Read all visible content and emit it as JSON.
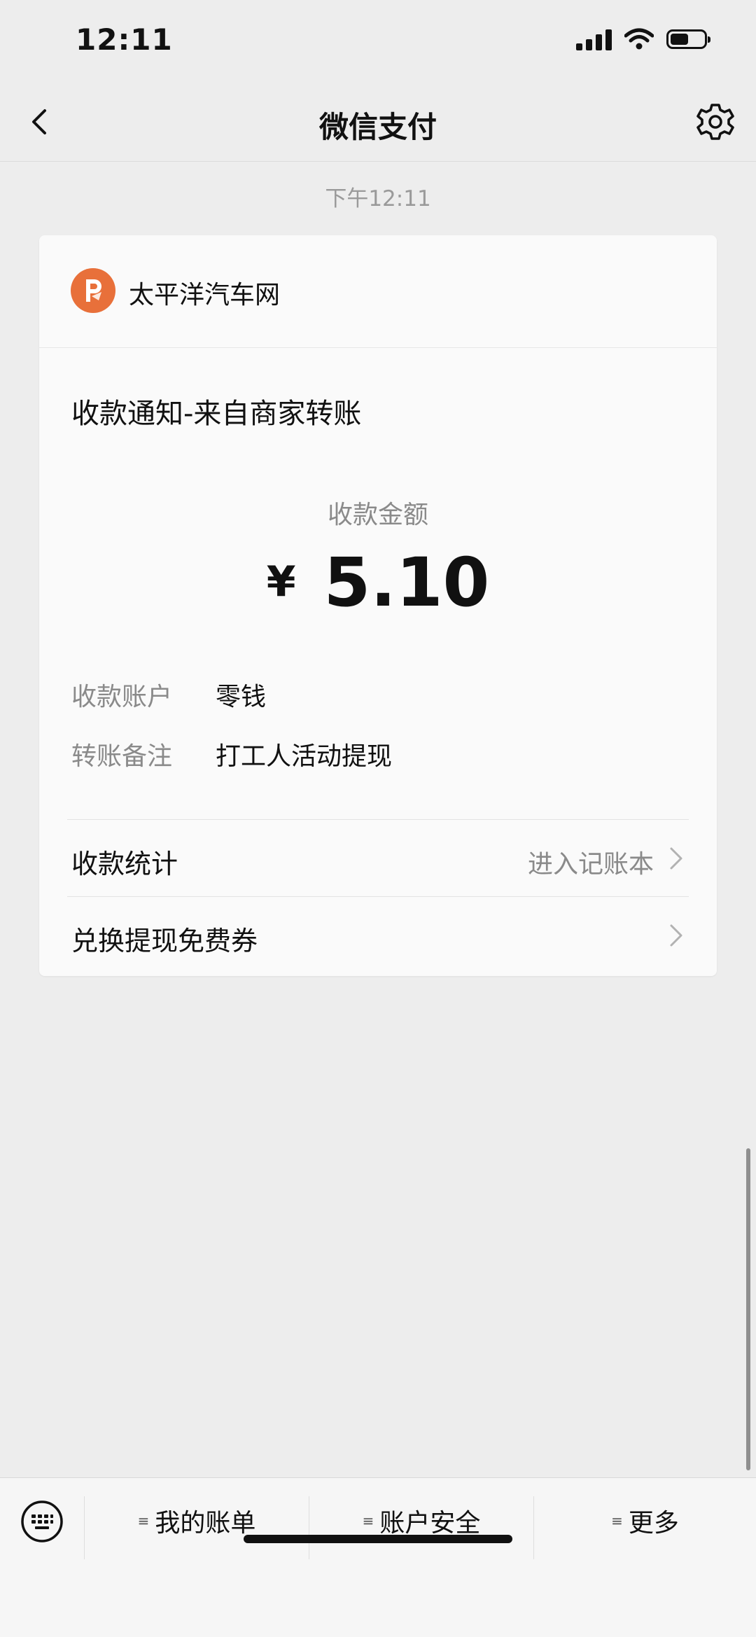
{
  "status_bar": {
    "time": "12:11",
    "battery_level": 0.55,
    "signal_bars": 4
  },
  "nav": {
    "title": "微信支付",
    "back_icon": "chevron-left-icon",
    "settings_icon": "gear-icon"
  },
  "chat": {
    "timestamp": "下午12:11"
  },
  "card": {
    "merchant_name": "太平洋汽车网",
    "merchant_logo_color": "#e8703a",
    "notice_title": "收款通知-来自商家转账",
    "amount_label": "收款金额",
    "currency_symbol": "¥",
    "amount_value": "5.10",
    "details": [
      {
        "key": "收款账户",
        "value": "零钱"
      },
      {
        "key": "转账备注",
        "value": "打工人活动提现"
      }
    ],
    "stats_row": {
      "label": "收款统计",
      "hint": "进入记账本"
    },
    "voucher_row": {
      "label": "兑换提现免费券"
    }
  },
  "bottom_menu": {
    "keyboard_icon": "keyboard-icon",
    "items": [
      {
        "label": "我的账单"
      },
      {
        "label": "账户安全"
      },
      {
        "label": "更多"
      }
    ]
  },
  "colors": {
    "background": "#ededed",
    "card": "#fafafa",
    "secondary_text": "#8a8a8a"
  }
}
